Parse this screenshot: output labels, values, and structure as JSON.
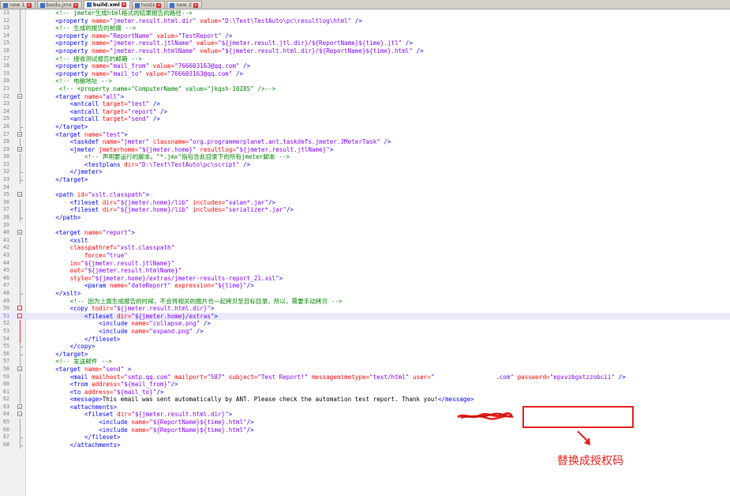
{
  "tabs": [
    {
      "label": "new 1",
      "active": false
    },
    {
      "label": "baidu.jmx",
      "active": false
    },
    {
      "label": "build.xml",
      "active": true
    },
    {
      "label": "hosts",
      "active": false
    },
    {
      "label": "new 2",
      "active": false
    }
  ],
  "lines": [
    {
      "n": "11",
      "fold": "bar",
      "tokens": [
        [
          "c",
          "    <!-- jmeter生成html格式的结果报告的路径-->"
        ]
      ]
    },
    {
      "n": "12",
      "fold": "bar",
      "tokens": [
        [
          "k",
          "    "
        ],
        [
          "t",
          "<property "
        ],
        [
          "a",
          "name="
        ],
        [
          "v",
          "\"jmeter.result.html.dir\" "
        ],
        [
          "a",
          "value="
        ],
        [
          "v",
          "\"D:\\Test\\TestAuto\\pc\\resultlog\\html\" "
        ],
        [
          "t",
          "/>"
        ]
      ]
    },
    {
      "n": "13",
      "fold": "bar",
      "tokens": [
        [
          "c",
          "    <!-- 生成的报告的前缀 -->"
        ]
      ]
    },
    {
      "n": "14",
      "fold": "bar",
      "tokens": [
        [
          "k",
          "    "
        ],
        [
          "t",
          "<property "
        ],
        [
          "a",
          "name="
        ],
        [
          "v",
          "\"ReportName\" "
        ],
        [
          "a",
          "value="
        ],
        [
          "v",
          "\"TestReport\" "
        ],
        [
          "t",
          "/>"
        ]
      ]
    },
    {
      "n": "15",
      "fold": "bar",
      "tokens": [
        [
          "k",
          "    "
        ],
        [
          "t",
          "<property "
        ],
        [
          "a",
          "name="
        ],
        [
          "v",
          "\"jmeter.result.jtlName\" "
        ],
        [
          "a",
          "value="
        ],
        [
          "v",
          "\"${jmeter.result.jtl.dir}/${ReportName}${time}.jtl\" "
        ],
        [
          "t",
          "/>"
        ]
      ]
    },
    {
      "n": "16",
      "fold": "bar",
      "tokens": [
        [
          "k",
          "    "
        ],
        [
          "t",
          "<property "
        ],
        [
          "a",
          "name="
        ],
        [
          "v",
          "\"jmeter.result.htmlName\" "
        ],
        [
          "a",
          "value="
        ],
        [
          "v",
          "\"${jmeter.result.html.dir}/${ReportName}${time}.html\" "
        ],
        [
          "t",
          "/>"
        ]
      ]
    },
    {
      "n": "17",
      "fold": "bar",
      "tokens": [
        [
          "c",
          "    <!-- 接收测试报告的邮箱 -->"
        ]
      ]
    },
    {
      "n": "18",
      "fold": "bar",
      "tokens": [
        [
          "k",
          "    "
        ],
        [
          "t",
          "<property "
        ],
        [
          "a",
          "name="
        ],
        [
          "v",
          "\"mail_from\" "
        ],
        [
          "a",
          "value="
        ],
        [
          "v",
          "\"766603163@qq.com\" "
        ],
        [
          "t",
          "/>"
        ]
      ]
    },
    {
      "n": "19",
      "fold": "bar",
      "tokens": [
        [
          "k",
          "    "
        ],
        [
          "t",
          "<property "
        ],
        [
          "a",
          "name="
        ],
        [
          "v",
          "\"mail_to\" "
        ],
        [
          "a",
          "value="
        ],
        [
          "v",
          "\"766603163@qq.com\" "
        ],
        [
          "t",
          "/>"
        ]
      ]
    },
    {
      "n": "20",
      "fold": "bar",
      "tokens": [
        [
          "c",
          "    <!-- 电脑地址 -->"
        ]
      ]
    },
    {
      "n": "21",
      "fold": "bar",
      "tokens": [
        [
          "c",
          "     <!-- <property name=\"ComputerName\" value=\"jkqsh-10285\" />-->"
        ]
      ]
    },
    {
      "n": "22",
      "fold": "box",
      "tokens": [
        [
          "k",
          "    "
        ],
        [
          "t",
          "<target "
        ],
        [
          "a",
          "name="
        ],
        [
          "v",
          "\"all\""
        ],
        [
          "t",
          ">"
        ]
      ]
    },
    {
      "n": "23",
      "fold": "bar",
      "tokens": [
        [
          "k",
          "        "
        ],
        [
          "t",
          "<antcall "
        ],
        [
          "a",
          "target="
        ],
        [
          "v",
          "\"test\" "
        ],
        [
          "t",
          "/>"
        ]
      ]
    },
    {
      "n": "24",
      "fold": "bar",
      "tokens": [
        [
          "k",
          "        "
        ],
        [
          "t",
          "<antcall "
        ],
        [
          "a",
          "target="
        ],
        [
          "v",
          "\"report\" "
        ],
        [
          "t",
          "/>"
        ]
      ]
    },
    {
      "n": "25",
      "fold": "bar",
      "tokens": [
        [
          "k",
          "        "
        ],
        [
          "t",
          "<antcall "
        ],
        [
          "a",
          "target="
        ],
        [
          "v",
          "\"send\" "
        ],
        [
          "t",
          "/>"
        ]
      ]
    },
    {
      "n": "26",
      "fold": "end",
      "tokens": [
        [
          "k",
          "    "
        ],
        [
          "t",
          "</target>"
        ]
      ]
    },
    {
      "n": "27",
      "fold": "box",
      "tokens": [
        [
          "k",
          "    "
        ],
        [
          "t",
          "<target "
        ],
        [
          "a",
          "name="
        ],
        [
          "v",
          "\"test\""
        ],
        [
          "t",
          ">"
        ]
      ]
    },
    {
      "n": "28",
      "fold": "bar",
      "tokens": [
        [
          "k",
          "        "
        ],
        [
          "t",
          "<taskdef "
        ],
        [
          "a",
          "name="
        ],
        [
          "v",
          "\"jmeter\" "
        ],
        [
          "a",
          "classname="
        ],
        [
          "v",
          "\"org.programmerplanet.ant.taskdefs.jmeter.JMeterTask\" "
        ],
        [
          "t",
          "/>"
        ]
      ]
    },
    {
      "n": "29",
      "fold": "box",
      "tokens": [
        [
          "k",
          "        "
        ],
        [
          "t",
          "<jmeter "
        ],
        [
          "a",
          "jmeterhome="
        ],
        [
          "v",
          "\"${jmeter.home}\" "
        ],
        [
          "a",
          "resultlog="
        ],
        [
          "v",
          "\"${jmeter.result.jtlName}\""
        ],
        [
          "t",
          ">"
        ]
      ]
    },
    {
      "n": "30",
      "fold": "bar",
      "tokens": [
        [
          "c",
          "            <!-- 声明要运行的脚本。\"*.jmx\"指包含此目录下的所有jmeter脚本 -->"
        ]
      ]
    },
    {
      "n": "31",
      "fold": "bar",
      "tokens": [
        [
          "k",
          "            "
        ],
        [
          "t",
          "<testplans "
        ],
        [
          "a",
          "dir="
        ],
        [
          "v",
          "\"D:\\Test\\TestAuto\\pc\\script\" "
        ],
        [
          "t",
          "/>"
        ]
      ]
    },
    {
      "n": "32",
      "fold": "end",
      "tokens": [
        [
          "k",
          "        "
        ],
        [
          "t",
          "</jmeter>"
        ]
      ]
    },
    {
      "n": "33",
      "fold": "end",
      "tokens": [
        [
          "k",
          "    "
        ],
        [
          "t",
          "</target>"
        ]
      ]
    },
    {
      "n": "34",
      "fold": "none",
      "tokens": []
    },
    {
      "n": "35",
      "fold": "box",
      "tokens": [
        [
          "k",
          "    "
        ],
        [
          "t",
          "<path "
        ],
        [
          "a",
          "id="
        ],
        [
          "v",
          "\"xslt.classpath\""
        ],
        [
          "t",
          ">"
        ]
      ]
    },
    {
      "n": "36",
      "fold": "bar",
      "tokens": [
        [
          "k",
          "        "
        ],
        [
          "t",
          "<fileset "
        ],
        [
          "a",
          "dir="
        ],
        [
          "v",
          "\"${jmeter.home}/lib\" "
        ],
        [
          "a",
          "includes="
        ],
        [
          "v",
          "\"xalan*.jar\""
        ],
        [
          "t",
          "/>"
        ]
      ]
    },
    {
      "n": "37",
      "fold": "bar",
      "tokens": [
        [
          "k",
          "        "
        ],
        [
          "t",
          "<fileset "
        ],
        [
          "a",
          "dir="
        ],
        [
          "v",
          "\"${jmeter.home}/lib\" "
        ],
        [
          "a",
          "includes="
        ],
        [
          "v",
          "\"serializer*.jar\""
        ],
        [
          "t",
          "/>"
        ]
      ]
    },
    {
      "n": "38",
      "fold": "end",
      "tokens": [
        [
          "k",
          "    "
        ],
        [
          "t",
          "</path>"
        ]
      ]
    },
    {
      "n": "39",
      "fold": "none",
      "tokens": []
    },
    {
      "n": "40",
      "fold": "box",
      "tokens": [
        [
          "k",
          "    "
        ],
        [
          "t",
          "<target "
        ],
        [
          "a",
          "name="
        ],
        [
          "v",
          "\"report\""
        ],
        [
          "t",
          ">"
        ]
      ]
    },
    {
      "n": "41",
      "fold": "bar",
      "tokens": [
        [
          "k",
          "        "
        ],
        [
          "t",
          "<xslt"
        ]
      ]
    },
    {
      "n": "42",
      "fold": "bar",
      "tokens": [
        [
          "k",
          "        "
        ],
        [
          "a",
          "classpathref="
        ],
        [
          "v",
          "\"xslt.classpath\""
        ]
      ]
    },
    {
      "n": "43",
      "fold": "bar",
      "tokens": [
        [
          "k",
          "            "
        ],
        [
          "a",
          "force="
        ],
        [
          "v",
          "\"true\""
        ]
      ]
    },
    {
      "n": "44",
      "fold": "bar",
      "tokens": [
        [
          "k",
          "        "
        ],
        [
          "a",
          "in="
        ],
        [
          "v",
          "\"${jmeter.result.jtlName}\""
        ]
      ]
    },
    {
      "n": "45",
      "fold": "bar",
      "tokens": [
        [
          "k",
          "        "
        ],
        [
          "a",
          "out="
        ],
        [
          "v",
          "\"${jmeter.result.htmlName}\""
        ]
      ]
    },
    {
      "n": "46",
      "fold": "bar",
      "tokens": [
        [
          "k",
          "        "
        ],
        [
          "a",
          "style="
        ],
        [
          "v",
          "\"${jmeter.home}/extras/jmeter-results-report_21.xsl\""
        ],
        [
          "t",
          ">"
        ]
      ]
    },
    {
      "n": "47",
      "fold": "bar",
      "tokens": [
        [
          "k",
          "            "
        ],
        [
          "t",
          "<param "
        ],
        [
          "a",
          "name="
        ],
        [
          "v",
          "\"dateReport\" "
        ],
        [
          "a",
          "expression="
        ],
        [
          "v",
          "\"${time}\""
        ],
        [
          "t",
          "/>"
        ]
      ]
    },
    {
      "n": "48",
      "fold": "end",
      "tokens": [
        [
          "k",
          "    "
        ],
        [
          "t",
          "</xslt>"
        ]
      ]
    },
    {
      "n": "49",
      "fold": "bar",
      "tokens": [
        [
          "c",
          "        <!-- 因为上面生成报告的时候，不会将相关的图片也一起拷贝至目标目录，所以，需要手动拷贝 -->"
        ]
      ]
    },
    {
      "n": "50",
      "fold": "redbox",
      "tokens": [
        [
          "k",
          "        "
        ],
        [
          "t",
          "<copy "
        ],
        [
          "a",
          "todir="
        ],
        [
          "v",
          "\"${jmeter.result.html.dir}\""
        ],
        [
          "t",
          ">"
        ]
      ]
    },
    {
      "n": "51",
      "fold": "redbox",
      "hl": true,
      "tokens": [
        [
          "k",
          "            "
        ],
        [
          "t",
          "<fileset "
        ],
        [
          "a",
          "dir="
        ],
        [
          "v",
          "\"${jmeter.home}/extras\""
        ],
        [
          "t",
          ">"
        ]
      ]
    },
    {
      "n": "52",
      "fold": "red",
      "tokens": [
        [
          "k",
          "                "
        ],
        [
          "t",
          "<include "
        ],
        [
          "a",
          "name="
        ],
        [
          "v",
          "\"collapse.png\" "
        ],
        [
          "t",
          "/>"
        ]
      ]
    },
    {
      "n": "53",
      "fold": "red",
      "tokens": [
        [
          "k",
          "                "
        ],
        [
          "t",
          "<include "
        ],
        [
          "a",
          "name="
        ],
        [
          "v",
          "\"expand.png\" "
        ],
        [
          "t",
          "/>"
        ]
      ]
    },
    {
      "n": "54",
      "fold": "red",
      "tokens": [
        [
          "k",
          "            "
        ],
        [
          "t",
          "</fileset>"
        ]
      ]
    },
    {
      "n": "55",
      "fold": "end",
      "tokens": [
        [
          "k",
          "        "
        ],
        [
          "t",
          "</copy>"
        ]
      ]
    },
    {
      "n": "56",
      "fold": "end",
      "tokens": [
        [
          "k",
          "    "
        ],
        [
          "t",
          "</target>"
        ]
      ]
    },
    {
      "n": "57",
      "fold": "bar",
      "tokens": [
        [
          "c",
          "    <!-- 发送邮件 -->"
        ]
      ]
    },
    {
      "n": "58",
      "fold": "box",
      "tokens": [
        [
          "k",
          "    "
        ],
        [
          "t",
          "<target "
        ],
        [
          "a",
          "name="
        ],
        [
          "v",
          "\"send\" "
        ],
        [
          "t",
          ">"
        ]
      ]
    },
    {
      "n": "59",
      "fold": "bar",
      "tokens": [
        [
          "k",
          "        "
        ],
        [
          "t",
          "<mail "
        ],
        [
          "a",
          "mailhost="
        ],
        [
          "v",
          "\"smtp.qq.com\" "
        ],
        [
          "a",
          "mailport="
        ],
        [
          "v",
          "\"587\" "
        ],
        [
          "a",
          "subject="
        ],
        [
          "v",
          "\"Test Report!\" "
        ],
        [
          "a",
          "messagemimetype="
        ],
        [
          "v",
          "\"text/html\" "
        ],
        [
          "a",
          "user="
        ],
        [
          "v",
          "\"                 .com\" "
        ],
        [
          "a",
          "password="
        ],
        [
          "v",
          "\"epxvzbgxtzzobcii\" "
        ],
        [
          "t",
          "/>"
        ]
      ]
    },
    {
      "n": "60",
      "fold": "bar",
      "tokens": [
        [
          "k",
          "        "
        ],
        [
          "t",
          "<from "
        ],
        [
          "a",
          "address="
        ],
        [
          "v",
          "\"${mail_from}\""
        ],
        [
          "t",
          "/>"
        ]
      ]
    },
    {
      "n": "61",
      "fold": "bar",
      "tokens": [
        [
          "k",
          "        "
        ],
        [
          "t",
          "<to "
        ],
        [
          "a",
          "address="
        ],
        [
          "v",
          "\"${mail_to}\""
        ],
        [
          "t",
          "/>"
        ]
      ]
    },
    {
      "n": "62",
      "fold": "bar",
      "tokens": [
        [
          "k",
          "        "
        ],
        [
          "t",
          "<message>"
        ],
        [
          "k",
          "This email was sent automatically by ANT. Please check the automation test report. Thank you!"
        ],
        [
          "t",
          "</message>"
        ]
      ]
    },
    {
      "n": "63",
      "fold": "box",
      "tokens": [
        [
          "k",
          "        "
        ],
        [
          "t",
          "<attachments>"
        ]
      ]
    },
    {
      "n": "64",
      "fold": "box",
      "tokens": [
        [
          "k",
          "            "
        ],
        [
          "t",
          "<fileset "
        ],
        [
          "a",
          "dir="
        ],
        [
          "v",
          "\"${jmeter.result.html.dir}\""
        ],
        [
          "t",
          ">"
        ]
      ]
    },
    {
      "n": "65",
      "fold": "bar",
      "tokens": [
        [
          "k",
          "                "
        ],
        [
          "t",
          "<include "
        ],
        [
          "a",
          "name="
        ],
        [
          "v",
          "\"${ReportName}${time}.html\""
        ],
        [
          "t",
          "/>"
        ]
      ]
    },
    {
      "n": "66",
      "fold": "bar",
      "tokens": [
        [
          "k",
          "                "
        ],
        [
          "t",
          "<include "
        ],
        [
          "a",
          "name="
        ],
        [
          "v",
          "\"${ReportName}${time}.html\""
        ],
        [
          "t",
          "/>"
        ]
      ]
    },
    {
      "n": "67",
      "fold": "end",
      "tokens": [
        [
          "k",
          "            "
        ],
        [
          "t",
          "</fileset>"
        ]
      ]
    },
    {
      "n": "68",
      "fold": "end",
      "tokens": [
        [
          "k",
          "        "
        ],
        [
          "t",
          "</attachments>"
        ]
      ]
    }
  ],
  "annotation": {
    "note": "替换成授权码",
    "color": "#e8201a"
  }
}
